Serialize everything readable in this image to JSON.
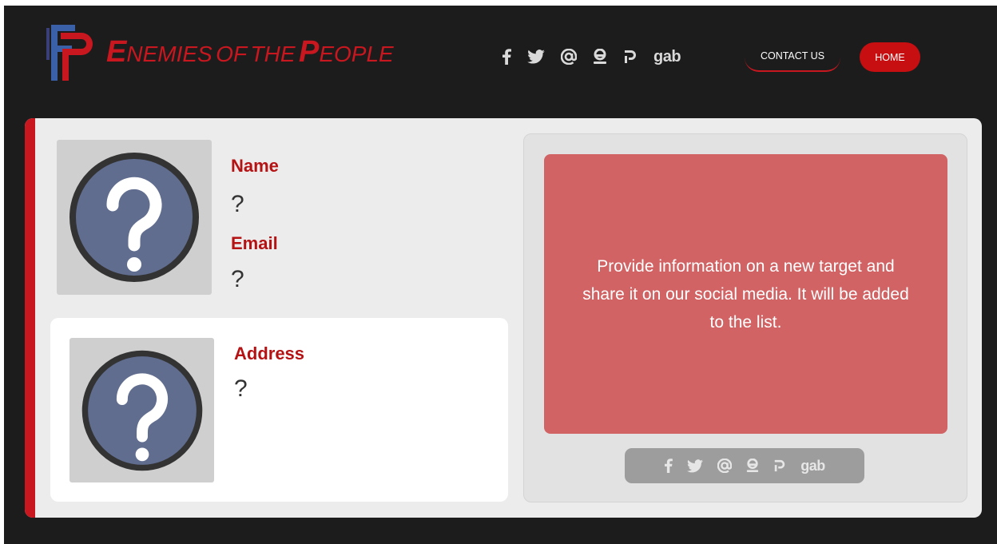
{
  "header": {
    "title_words": [
      {
        "cap": "E",
        "rest": "NEMIES"
      },
      {
        "cap": "",
        "rest": "OF"
      },
      {
        "cap": "",
        "rest": "THE"
      },
      {
        "cap": "P",
        "rest": "EOPLE"
      }
    ],
    "socials": [
      {
        "name": "facebook-icon"
      },
      {
        "name": "twitter-icon"
      },
      {
        "name": "at-email-icon"
      },
      {
        "name": "gettr-icon"
      },
      {
        "name": "parler-icon"
      },
      {
        "name": "gab-icon",
        "text": "gab"
      }
    ],
    "contact_label": "CONTACT US",
    "home_label": "HOME"
  },
  "profile": {
    "name_label": "Name",
    "name_value": "?",
    "email_label": "Email",
    "email_value": "?",
    "address_label": "Address",
    "address_value": "?"
  },
  "info": {
    "message": "Provide information on a new target and share it on our social media. It will be added to the list."
  },
  "share": {
    "gab_text": "gab"
  },
  "colors": {
    "background": "#1c1c1d",
    "accent": "#c8171e",
    "info_box": "#d16364",
    "card": "#ececec"
  }
}
